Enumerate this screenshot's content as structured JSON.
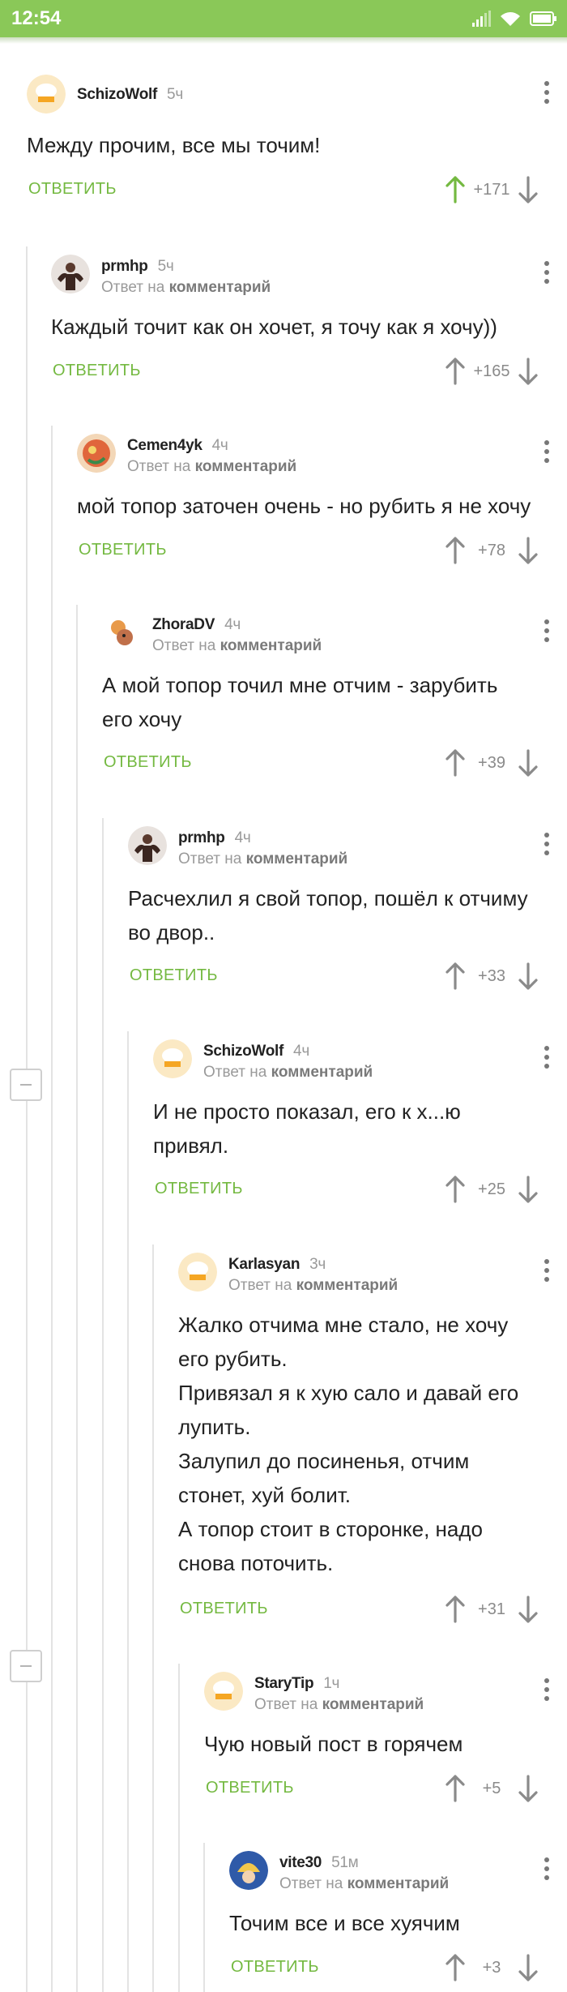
{
  "status_bar": {
    "time": "12:54"
  },
  "comments": [
    {
      "author": "SchizoWolf",
      "time": "5ч",
      "reply_to": null,
      "text_lines": [
        "Между прочим, все мы точим!"
      ],
      "reply_label": "ОТВЕТИТЬ",
      "score": "+171",
      "upvoted": true,
      "avatar": "chef-hat-avatar"
    },
    {
      "author": "prmhp",
      "time": "5ч",
      "reply_to_prefix": "Ответ на",
      "reply_to": "комментарий",
      "text_lines": [
        "Каждый точит как он хочет, я точу как я хочу))"
      ],
      "reply_label": "ОТВЕТИТЬ",
      "score": "+165",
      "upvoted": false,
      "avatar": "bodybuilder-avatar"
    },
    {
      "author": "Cemen4yk",
      "time": "4ч",
      "reply_to_prefix": "Ответ на",
      "reply_to": "комментарий",
      "text_lines": [
        "мой топор заточен очень - но рубить я не хочу"
      ],
      "reply_label": "ОТВЕТИТЬ",
      "score": "+78",
      "upvoted": false,
      "avatar": "dragon-avatar"
    },
    {
      "author": "ZhoraDV",
      "time": "4ч",
      "reply_to_prefix": "Ответ на",
      "reply_to": "комментарий",
      "text_lines": [
        "А мой топор точил мне отчим - зарубить",
        "его хочу"
      ],
      "reply_label": "ОТВЕТИТЬ",
      "score": "+39",
      "upvoted": false,
      "avatar": "cartoon-avatar"
    },
    {
      "author": "prmhp",
      "time": "4ч",
      "reply_to_prefix": "Ответ на",
      "reply_to": "комментарий",
      "text_lines": [
        "Расчехлил я свой топор, пошёл к отчиму",
        "во двор.."
      ],
      "reply_label": "ОТВЕТИТЬ",
      "score": "+33",
      "upvoted": false,
      "avatar": "bodybuilder-avatar"
    },
    {
      "author": "SchizoWolf",
      "time": "4ч",
      "reply_to_prefix": "Ответ на",
      "reply_to": "комментарий",
      "text_lines": [
        "И не просто показал, его к х...ю",
        "привял."
      ],
      "reply_label": "ОТВЕТИТЬ",
      "score": "+25",
      "upvoted": false,
      "avatar": "chef-hat-avatar"
    },
    {
      "author": "Karlasyan",
      "time": "3ч",
      "reply_to_prefix": "Ответ на",
      "reply_to": "комментарий",
      "text_lines": [
        "Жалко отчима мне стало, не хочу",
        "его рубить.",
        "Привязал я к хую сало и давай его",
        "лупить.",
        "Залупил до посиненья, отчим",
        "стонет, хуй болит.",
        "А топор стоит в сторонке, надо",
        "снова поточить."
      ],
      "reply_label": "ОТВЕТИТЬ",
      "score": "+31",
      "upvoted": false,
      "avatar": "chef-hat-avatar"
    },
    {
      "author": "StaryTip",
      "time": "1ч",
      "reply_to_prefix": "Ответ на",
      "reply_to": "комментарий",
      "text_lines": [
        "Чую новый пост в горячем"
      ],
      "reply_label": "ОТВЕТИТЬ",
      "score": "+5",
      "upvoted": false,
      "avatar": "chef-hat-avatar"
    },
    {
      "author": "vite30",
      "time": "51м",
      "reply_to_prefix": "Ответ на",
      "reply_to": "комментарий",
      "text_lines": [
        "Точим все и все хуячим"
      ],
      "reply_label": "ОТВЕТИТЬ",
      "score": "+3",
      "upvoted": false,
      "avatar": "cap-avatar"
    }
  ],
  "colors": {
    "accent_green": "#74b941",
    "status_bar": "#8ac858",
    "muted": "#9a9a9a"
  }
}
